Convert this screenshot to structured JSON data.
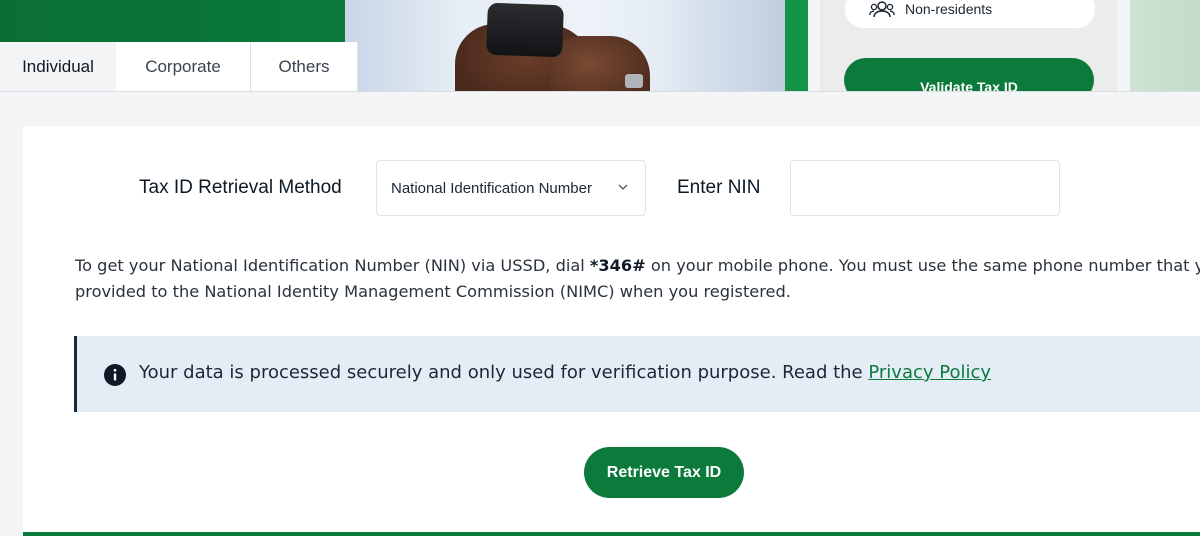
{
  "banner": {
    "side_card_label": "Non-residents",
    "side_card_icon": "users-icon",
    "validate_button": "Validate Tax ID"
  },
  "tabs": [
    {
      "label": "Individual",
      "active": true
    },
    {
      "label": "Corporate",
      "active": false
    },
    {
      "label": "Others",
      "active": false
    }
  ],
  "form": {
    "method_label": "Tax ID Retrieval Method",
    "method_selected": "National Identification Number",
    "nin_label": "Enter NIN",
    "nin_value": "",
    "nin_placeholder": ""
  },
  "ussd_info": {
    "line1_prefix": "To get your National Identification Number (NIN) via USSD, dial ",
    "code": "*346#",
    "line1_suffix": " on your mobile phone. You must use the same phone number that you",
    "line2": "provided to the National Identity Management Commission (NIMC) when you registered."
  },
  "notice": {
    "icon": "info-icon",
    "text": "Your data is processed securely and only used for verification purpose. Read the ",
    "link": "Privacy Policy"
  },
  "actions": {
    "retrieve_button": "Retrieve Tax ID"
  },
  "colors": {
    "brand_green": "#0b7a3b",
    "notice_bg": "#e4edf6",
    "notice_border": "#1b2a38"
  }
}
